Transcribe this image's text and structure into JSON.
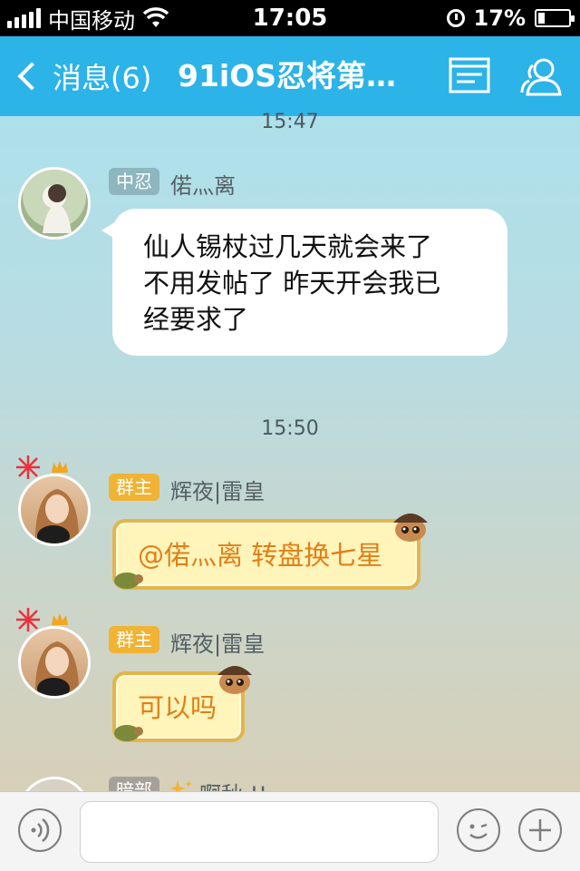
{
  "status_bar": {
    "carrier": "中国移动",
    "time": "17:05",
    "battery_percent": "17%"
  },
  "nav": {
    "back_label": "消息(6)",
    "title": "91iOS忍将第…"
  },
  "chat": {
    "partial_timestamp": "15:47",
    "messages_group1": {
      "badge": "中忍",
      "sender": "偌灬离",
      "lines": [
        "仙人锡杖过几天就会来了",
        "不用发帖了 昨天开会我已",
        "经要求了"
      ]
    },
    "timestamp2": "15:50",
    "message2": {
      "badge": "群主",
      "sender": "辉夜|雷皇",
      "text": "@偌灬离 转盘换七星"
    },
    "message3": {
      "badge": "群主",
      "sender": "辉夜|雷皇",
      "text": "可以吗"
    },
    "message4_partial": {
      "badge": "暗部",
      "sender": "啊秋 !!"
    }
  },
  "colors": {
    "nav_bg": "#2cb3e8",
    "gold_badge": "#f1b333",
    "gray_badge": "#8eb6be",
    "gold_text": "#e07f18"
  }
}
